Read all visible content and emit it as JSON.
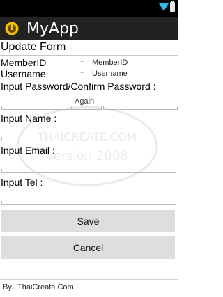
{
  "app": {
    "title": "MyApp"
  },
  "form": {
    "title": "Update Form",
    "member_id": {
      "label": "MemberID",
      "separator": "=",
      "value": "MemberID"
    },
    "username": {
      "label": "Username",
      "separator": "=",
      "value": "Username"
    },
    "password_label": "Input Password/Confirm Password :",
    "password_again_placeholder": "Again",
    "name_label": "Input Name :",
    "email_label": "Input Email :",
    "tel_label": "Input Tel :"
  },
  "buttons": {
    "save": "Save",
    "cancel": "Cancel"
  },
  "watermark": {
    "line1": "THAICREATE.COM",
    "line2": "Version 2008"
  },
  "footer": {
    "text": "By.. ThaiCreate.Com"
  }
}
